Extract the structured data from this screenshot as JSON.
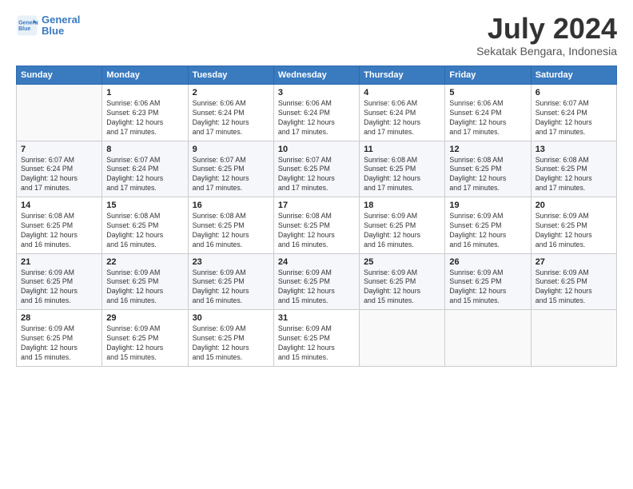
{
  "logo": {
    "line1": "General",
    "line2": "Blue"
  },
  "title": "July 2024",
  "subtitle": "Sekatak Bengara, Indonesia",
  "header_days": [
    "Sunday",
    "Monday",
    "Tuesday",
    "Wednesday",
    "Thursday",
    "Friday",
    "Saturday"
  ],
  "weeks": [
    [
      {
        "day": "",
        "info": ""
      },
      {
        "day": "1",
        "info": "Sunrise: 6:06 AM\nSunset: 6:23 PM\nDaylight: 12 hours\nand 17 minutes."
      },
      {
        "day": "2",
        "info": "Sunrise: 6:06 AM\nSunset: 6:24 PM\nDaylight: 12 hours\nand 17 minutes."
      },
      {
        "day": "3",
        "info": "Sunrise: 6:06 AM\nSunset: 6:24 PM\nDaylight: 12 hours\nand 17 minutes."
      },
      {
        "day": "4",
        "info": "Sunrise: 6:06 AM\nSunset: 6:24 PM\nDaylight: 12 hours\nand 17 minutes."
      },
      {
        "day": "5",
        "info": "Sunrise: 6:06 AM\nSunset: 6:24 PM\nDaylight: 12 hours\nand 17 minutes."
      },
      {
        "day": "6",
        "info": "Sunrise: 6:07 AM\nSunset: 6:24 PM\nDaylight: 12 hours\nand 17 minutes."
      }
    ],
    [
      {
        "day": "7",
        "info": "Sunrise: 6:07 AM\nSunset: 6:24 PM\nDaylight: 12 hours\nand 17 minutes."
      },
      {
        "day": "8",
        "info": "Sunrise: 6:07 AM\nSunset: 6:24 PM\nDaylight: 12 hours\nand 17 minutes."
      },
      {
        "day": "9",
        "info": "Sunrise: 6:07 AM\nSunset: 6:25 PM\nDaylight: 12 hours\nand 17 minutes."
      },
      {
        "day": "10",
        "info": "Sunrise: 6:07 AM\nSunset: 6:25 PM\nDaylight: 12 hours\nand 17 minutes."
      },
      {
        "day": "11",
        "info": "Sunrise: 6:08 AM\nSunset: 6:25 PM\nDaylight: 12 hours\nand 17 minutes."
      },
      {
        "day": "12",
        "info": "Sunrise: 6:08 AM\nSunset: 6:25 PM\nDaylight: 12 hours\nand 17 minutes."
      },
      {
        "day": "13",
        "info": "Sunrise: 6:08 AM\nSunset: 6:25 PM\nDaylight: 12 hours\nand 17 minutes."
      }
    ],
    [
      {
        "day": "14",
        "info": "Sunrise: 6:08 AM\nSunset: 6:25 PM\nDaylight: 12 hours\nand 16 minutes."
      },
      {
        "day": "15",
        "info": "Sunrise: 6:08 AM\nSunset: 6:25 PM\nDaylight: 12 hours\nand 16 minutes."
      },
      {
        "day": "16",
        "info": "Sunrise: 6:08 AM\nSunset: 6:25 PM\nDaylight: 12 hours\nand 16 minutes."
      },
      {
        "day": "17",
        "info": "Sunrise: 6:08 AM\nSunset: 6:25 PM\nDaylight: 12 hours\nand 16 minutes."
      },
      {
        "day": "18",
        "info": "Sunrise: 6:09 AM\nSunset: 6:25 PM\nDaylight: 12 hours\nand 16 minutes."
      },
      {
        "day": "19",
        "info": "Sunrise: 6:09 AM\nSunset: 6:25 PM\nDaylight: 12 hours\nand 16 minutes."
      },
      {
        "day": "20",
        "info": "Sunrise: 6:09 AM\nSunset: 6:25 PM\nDaylight: 12 hours\nand 16 minutes."
      }
    ],
    [
      {
        "day": "21",
        "info": "Sunrise: 6:09 AM\nSunset: 6:25 PM\nDaylight: 12 hours\nand 16 minutes."
      },
      {
        "day": "22",
        "info": "Sunrise: 6:09 AM\nSunset: 6:25 PM\nDaylight: 12 hours\nand 16 minutes."
      },
      {
        "day": "23",
        "info": "Sunrise: 6:09 AM\nSunset: 6:25 PM\nDaylight: 12 hours\nand 16 minutes."
      },
      {
        "day": "24",
        "info": "Sunrise: 6:09 AM\nSunset: 6:25 PM\nDaylight: 12 hours\nand 15 minutes."
      },
      {
        "day": "25",
        "info": "Sunrise: 6:09 AM\nSunset: 6:25 PM\nDaylight: 12 hours\nand 15 minutes."
      },
      {
        "day": "26",
        "info": "Sunrise: 6:09 AM\nSunset: 6:25 PM\nDaylight: 12 hours\nand 15 minutes."
      },
      {
        "day": "27",
        "info": "Sunrise: 6:09 AM\nSunset: 6:25 PM\nDaylight: 12 hours\nand 15 minutes."
      }
    ],
    [
      {
        "day": "28",
        "info": "Sunrise: 6:09 AM\nSunset: 6:25 PM\nDaylight: 12 hours\nand 15 minutes."
      },
      {
        "day": "29",
        "info": "Sunrise: 6:09 AM\nSunset: 6:25 PM\nDaylight: 12 hours\nand 15 minutes."
      },
      {
        "day": "30",
        "info": "Sunrise: 6:09 AM\nSunset: 6:25 PM\nDaylight: 12 hours\nand 15 minutes."
      },
      {
        "day": "31",
        "info": "Sunrise: 6:09 AM\nSunset: 6:25 PM\nDaylight: 12 hours\nand 15 minutes."
      },
      {
        "day": "",
        "info": ""
      },
      {
        "day": "",
        "info": ""
      },
      {
        "day": "",
        "info": ""
      }
    ]
  ]
}
